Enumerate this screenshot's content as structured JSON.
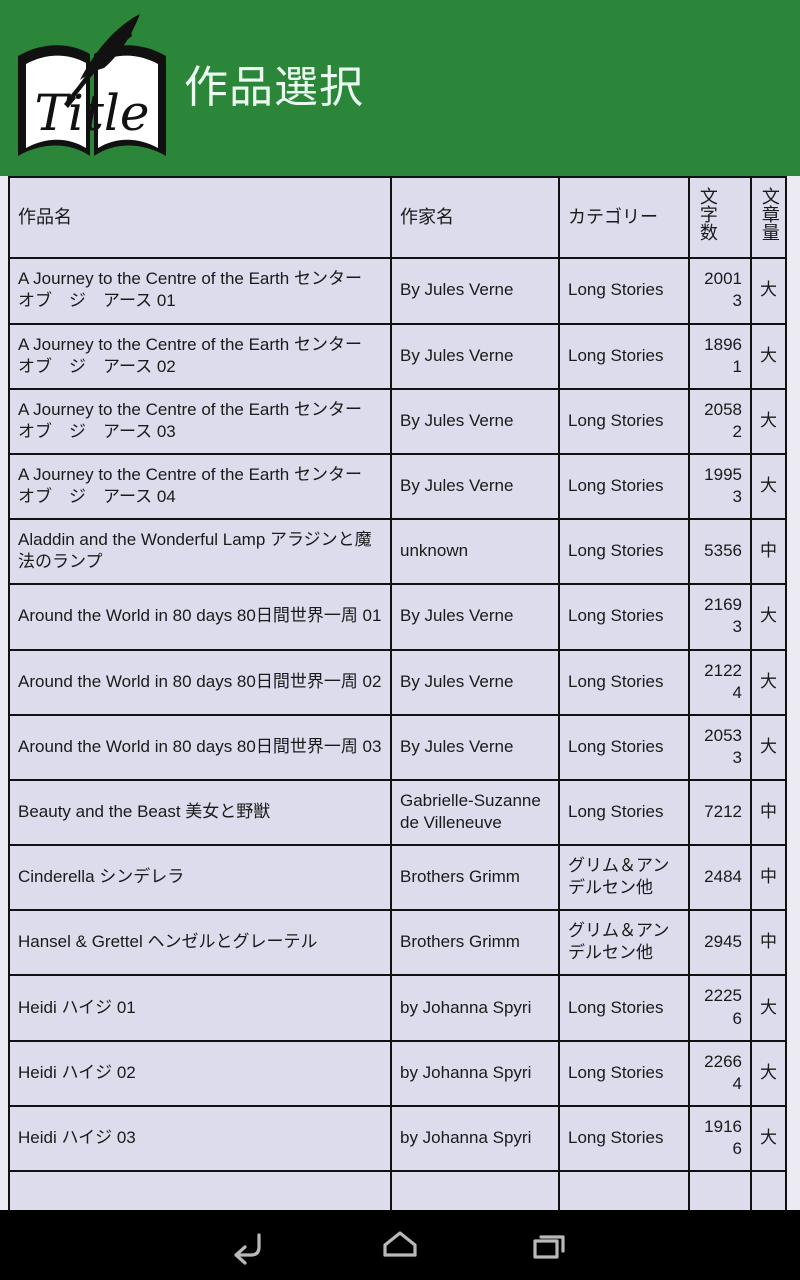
{
  "header": {
    "title": "作品選択",
    "logo_text": "Title",
    "logo_name": "title-book-quill-logo",
    "bg_color": "#2b8639",
    "title_color": "#eafaf0"
  },
  "table": {
    "columns": [
      {
        "key": "title",
        "label": "作品名",
        "orientation": "horizontal"
      },
      {
        "key": "author",
        "label": "作家名",
        "orientation": "horizontal"
      },
      {
        "key": "cat",
        "label": "カテゴリー",
        "orientation": "horizontal"
      },
      {
        "key": "count",
        "label": "文字数",
        "orientation": "vertical"
      },
      {
        "key": "vol",
        "label": "文章量",
        "orientation": "vertical"
      }
    ],
    "cell_bg": "#dcdcec",
    "border_color": "#111111",
    "text_color": "#1a1a1a",
    "highlight_color": "#c41238",
    "rows": [
      {
        "title": "A Journey to the Centre of the Earth センター　オブ　ジ　アース 01",
        "author": "By Jules Verne",
        "cat": "Long Stories",
        "count": "20013",
        "vol": "大",
        "highlighted": false
      },
      {
        "title": "A Journey to the Centre of the Earth センター　オブ　ジ　アース 02",
        "author": "By Jules Verne",
        "cat": "Long Stories",
        "count": "18961",
        "vol": "大",
        "highlighted": false
      },
      {
        "title": "A Journey to the Centre of the Earth センター　オブ　ジ　アース 03",
        "author": "By Jules Verne",
        "cat": "Long Stories",
        "count": "20582",
        "vol": "大",
        "highlighted": false
      },
      {
        "title": "A Journey to the Centre of the Earth センター　オブ　ジ　アース 04",
        "author": "By Jules Verne",
        "cat": "Long Stories",
        "count": "19953",
        "vol": "大",
        "highlighted": false
      },
      {
        "title": "Aladdin and the Wonderful Lamp アラジンと魔法のランプ",
        "author": "unknown",
        "cat": "Long Stories",
        "count": "5356",
        "vol": "中",
        "highlighted": false
      },
      {
        "title": "Around the World in 80 days 80日間世界一周 01",
        "author": "By Jules Verne",
        "cat": "Long Stories",
        "count": "21693",
        "vol": "大",
        "highlighted": true
      },
      {
        "title": "Around the World in 80 days 80日間世界一周 02",
        "author": "By Jules Verne",
        "cat": "Long Stories",
        "count": "21224",
        "vol": "大",
        "highlighted": true
      },
      {
        "title": "Around the World in 80 days 80日間世界一周 03",
        "author": "By Jules Verne",
        "cat": "Long Stories",
        "count": "20533",
        "vol": "大",
        "highlighted": false
      },
      {
        "title": "Beauty and the Beast 美女と野獣",
        "author": "Gabrielle-Suzanne de Villeneuve",
        "cat": "Long Stories",
        "count": "7212",
        "vol": "中",
        "highlighted": true
      },
      {
        "title": "Cinderella シンデレラ",
        "author": "Brothers Grimm",
        "cat": "グリム＆アンデルセン他",
        "count": "2484",
        "vol": "中",
        "highlighted": true
      },
      {
        "title": "Hansel & Grettel ヘンゼルとグレーテル",
        "author": "Brothers Grimm",
        "cat": "グリム＆アンデルセン他",
        "count": "2945",
        "vol": "中",
        "highlighted": true
      },
      {
        "title": "Heidi ハイジ 01",
        "author": "by Johanna Spyri",
        "cat": "Long Stories",
        "count": "22256",
        "vol": "大",
        "highlighted": false
      },
      {
        "title": "Heidi ハイジ 02",
        "author": "by Johanna Spyri",
        "cat": "Long Stories",
        "count": "22664",
        "vol": "大",
        "highlighted": false
      },
      {
        "title": "Heidi ハイジ 03",
        "author": "by Johanna Spyri",
        "cat": "Long Stories",
        "count": "19166",
        "vol": "大",
        "highlighted": false
      },
      {
        "title": "",
        "author": "",
        "cat": "",
        "count": "",
        "vol": "",
        "highlighted": false
      }
    ]
  },
  "navbar": {
    "bg_color": "#000000",
    "buttons": [
      {
        "name": "back-icon",
        "label": "Back"
      },
      {
        "name": "home-icon",
        "label": "Home"
      },
      {
        "name": "recents-icon",
        "label": "Recents"
      }
    ]
  }
}
